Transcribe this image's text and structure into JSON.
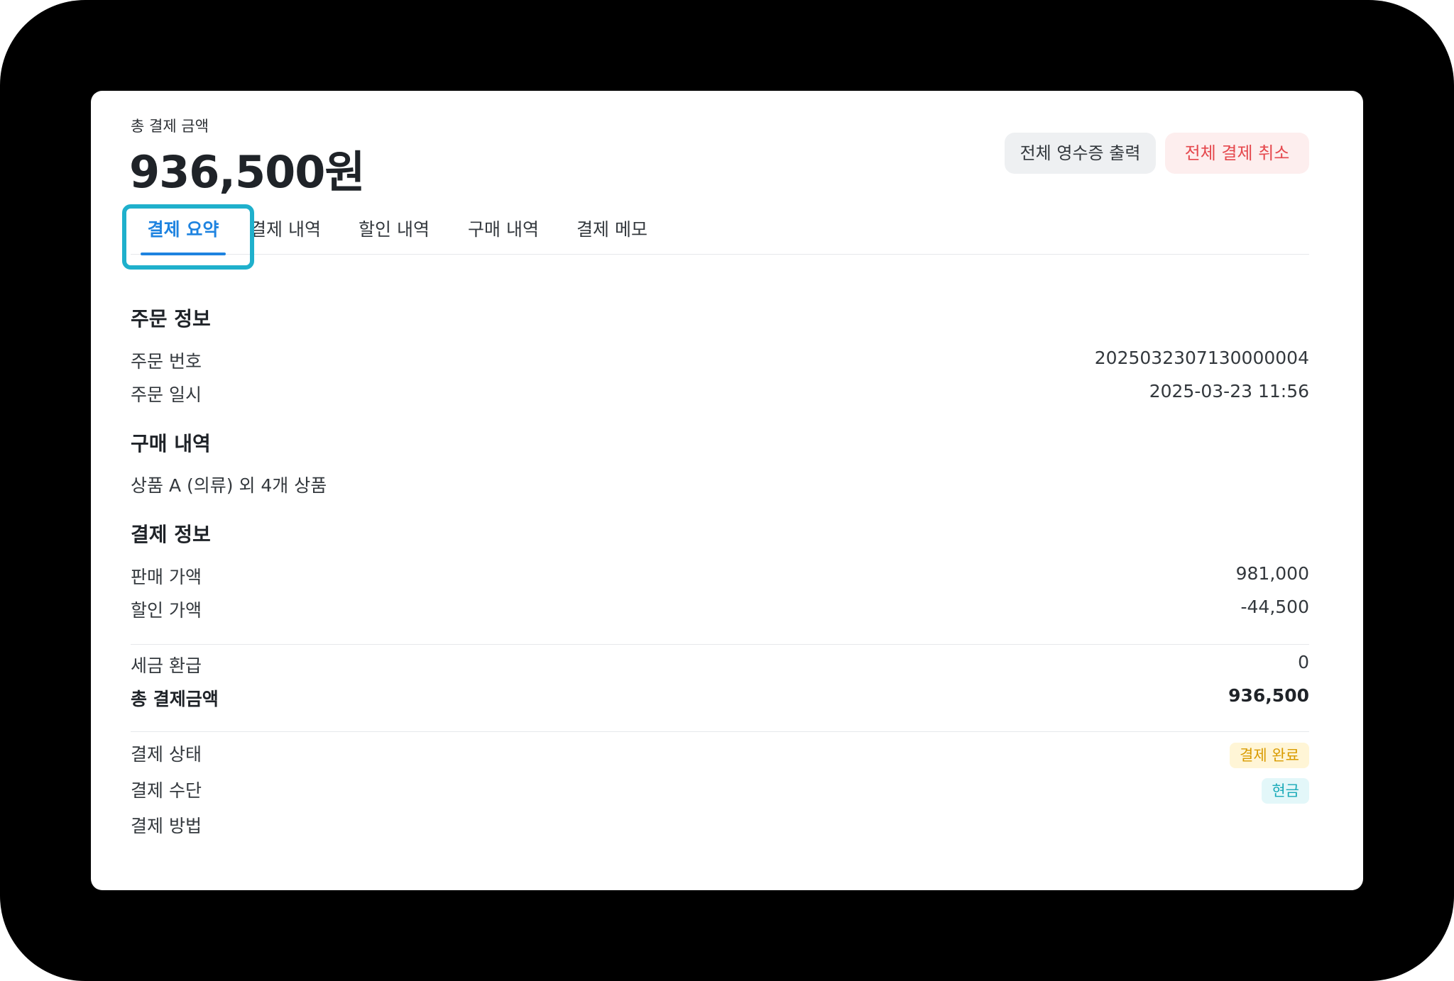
{
  "header": {
    "total_label": "총 결제 금액",
    "total_amount": "936,500원"
  },
  "actions": {
    "print_all_receipts": "전체 영수증 출력",
    "cancel_all_payments": "전체 결제 취소"
  },
  "tabs": [
    {
      "label": "결제 요약",
      "active": true
    },
    {
      "label": "결제 내역",
      "active": false
    },
    {
      "label": "할인 내역",
      "active": false
    },
    {
      "label": "구매 내역",
      "active": false
    },
    {
      "label": "결제 메모",
      "active": false
    }
  ],
  "order_info": {
    "title": "주문 정보",
    "order_number_label": "주문 번호",
    "order_number": "2025032307130000004",
    "order_date_label": "주문 일시",
    "order_date": "2025-03-23 11:56"
  },
  "purchase": {
    "title": "구매 내역",
    "summary": "상품 A (의류) 외 4개 상품"
  },
  "payment_info": {
    "title": "결제 정보",
    "sale_price_label": "판매 가액",
    "sale_price": "981,000",
    "discount_label": "할인 가액",
    "discount": "-44,500",
    "tax_refund_label": "세금 환급",
    "tax_refund": "0",
    "total_label": "총 결제금액",
    "total": "936,500",
    "status_label": "결제 상태",
    "status": "결제 완료",
    "means_label": "결제 수단",
    "means": "현금",
    "method_label": "결제 방법"
  },
  "colors": {
    "accent": "#1e83e0",
    "cancel": "#e5484d",
    "status_badge": "#d99b00",
    "method_badge": "#19aab8",
    "focus_ring": "#1fb0cc"
  }
}
